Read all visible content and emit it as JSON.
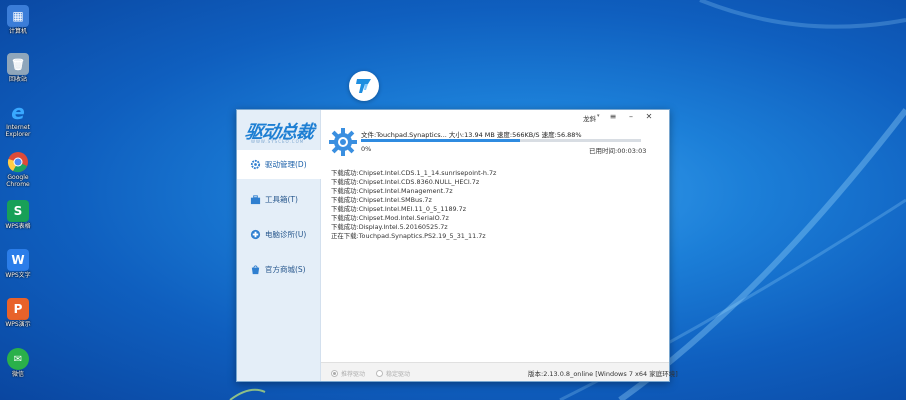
{
  "desktop": {
    "icons": [
      {
        "name": "computer",
        "label": "计算机",
        "glyph": "▦",
        "color": "#3b7dd8"
      },
      {
        "name": "recycle-bin",
        "label": "回收站",
        "glyph": "🗑",
        "color": "#8fa6bb"
      },
      {
        "name": "ie",
        "label": "Internet Explorer",
        "glyph": "e",
        "color": "#1e90ff"
      },
      {
        "name": "chrome",
        "label": "Google Chrome",
        "glyph": "◉",
        "color": "#dd4b39"
      },
      {
        "name": "wps-office",
        "label": "WPS表格",
        "glyph": "S",
        "color": "#18a058"
      },
      {
        "name": "wps-writer",
        "label": "WPS文字",
        "glyph": "W",
        "color": "#2b7de9"
      },
      {
        "name": "wps-ppt",
        "label": "WPS演示",
        "glyph": "P",
        "color": "#e8622a"
      },
      {
        "name": "wechat",
        "label": "微信",
        "glyph": "✉",
        "color": "#2ab04a"
      }
    ]
  },
  "app": {
    "brand": "驱动总裁",
    "brand_sub": "WWW.SYSCEO.COM",
    "user": "龙斜",
    "nav": [
      {
        "label": "驱动管理(D)",
        "icon": "gear-icon"
      },
      {
        "label": "工具箱(T)",
        "icon": "toolbox-icon"
      },
      {
        "label": "电脑诊所(U)",
        "icon": "clinic-icon"
      },
      {
        "label": "官方商城(S)",
        "icon": "shop-icon"
      }
    ],
    "download": {
      "file_line": "文件:Touchpad.Synaptics... 大小:13.94 MB 速度:566KB/S 速度:56.88%",
      "percent_label": "0%",
      "progress": 0.5688,
      "elapsed": "已用时间:00:03:03"
    },
    "log": [
      "下载成功:Chipset.Intel.CDS.1_1_14.sunrisepoint-h.7z",
      "下载成功:Chipset.Intel.CDS.8360.NULL_HECI.7z",
      "下载成功:Chipset.Intel.Management.7z",
      "下载成功:Chipset.Intel.SMBus.7z",
      "下载成功:Chipset.Intel.MEI.11_0_5_1189.7z",
      "下载成功:Chipset.Mod.Intel.SerialO.7z",
      "下载成功:Display.Intel.5.20160525.7z",
      "正在下载:Touchpad.Synaptics.PS2.19_5_31_11.7z"
    ],
    "bottom": {
      "option1": "推荐驱动",
      "option2": "稳定驱动",
      "version": "版本:2.13.0.8_online [Windows 7 x64 家庭环境]"
    },
    "colors": {
      "accent": "#2f8be0",
      "sidebar": "#e4eef8"
    }
  }
}
